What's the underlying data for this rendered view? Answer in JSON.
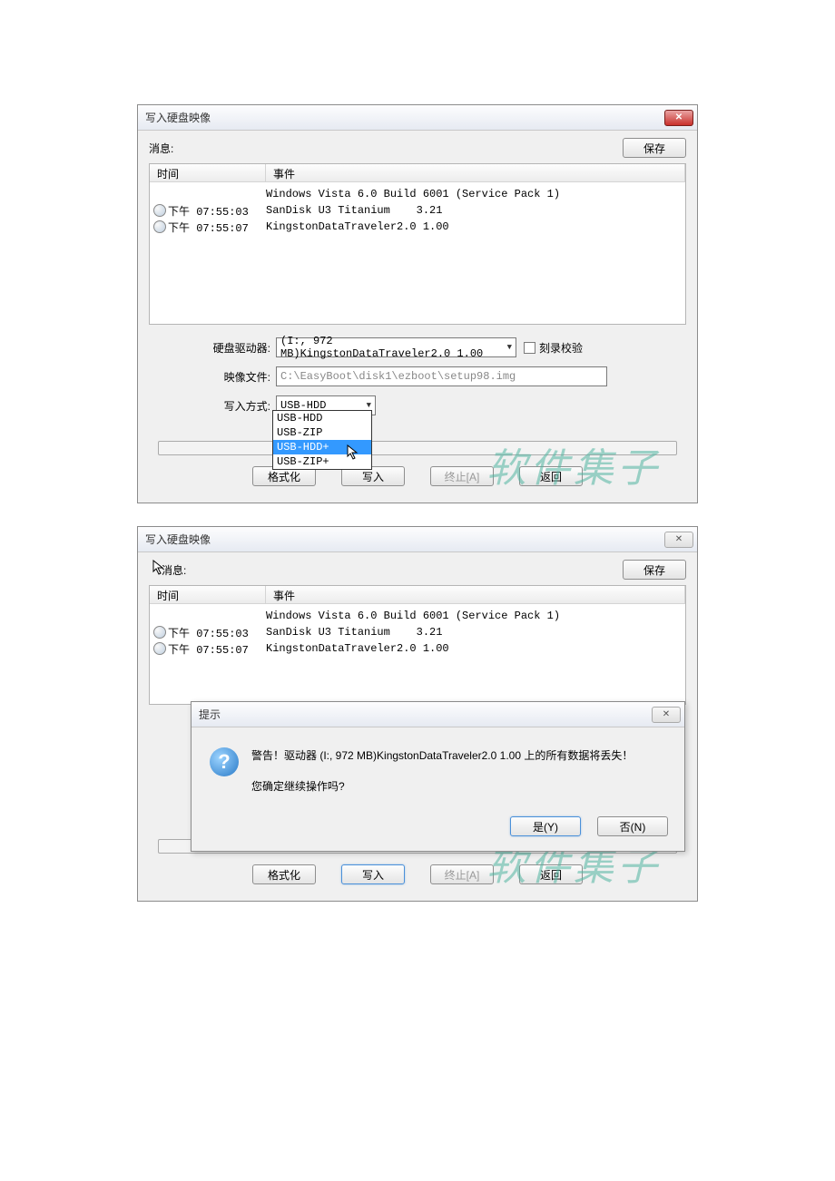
{
  "dialog1": {
    "title": "写入硬盘映像",
    "msg_label": "消息:",
    "save_btn": "保存",
    "col_time": "时间",
    "col_event": "事件",
    "log": [
      {
        "time": "",
        "event": "Windows Vista 6.0 Build 6001 (Service Pack 1)"
      },
      {
        "time": "下午 07:55:03",
        "event": "SanDisk U3 Titanium    3.21"
      },
      {
        "time": "下午 07:55:07",
        "event": "KingstonDataTraveler2.0 1.00"
      }
    ],
    "drive_label": "硬盘驱动器:",
    "drive_value": "(I:, 972 MB)KingstonDataTraveler2.0 1.00",
    "verify_label": "刻录校验",
    "image_label": "映像文件:",
    "image_value": "C:\\EasyBoot\\disk1\\ezboot\\setup98.img",
    "mode_label": "写入方式:",
    "mode_value": "USB-HDD",
    "mode_options": [
      "USB-HDD",
      "USB-ZIP",
      "USB-HDD+",
      "USB-ZIP+"
    ],
    "btn_format": "格式化",
    "btn_write": "写入",
    "btn_stop": "终止[A]",
    "btn_return": "返回"
  },
  "dialog2": {
    "title": "写入硬盘映像",
    "msg_label": "消息:",
    "save_btn": "保存",
    "col_time": "时间",
    "col_event": "事件",
    "log": [
      {
        "time": "",
        "event": "Windows Vista 6.0 Build 6001 (Service Pack 1)"
      },
      {
        "time": "下午 07:55:03",
        "event": "SanDisk U3 Titanium    3.21"
      },
      {
        "time": "下午 07:55:07",
        "event": "KingstonDataTraveler2.0 1.00"
      }
    ],
    "btn_format": "格式化",
    "btn_write": "写入",
    "btn_stop": "终止[A]",
    "btn_return": "返回"
  },
  "prompt": {
    "title": "提示",
    "line1": "警告！驱动器 (I:, 972 MB)KingstonDataTraveler2.0 1.00 上的所有数据将丢失！",
    "line2": "您确定继续操作吗?",
    "yes": "是(Y)",
    "no": "否(N)"
  },
  "watermark": "软件集子"
}
